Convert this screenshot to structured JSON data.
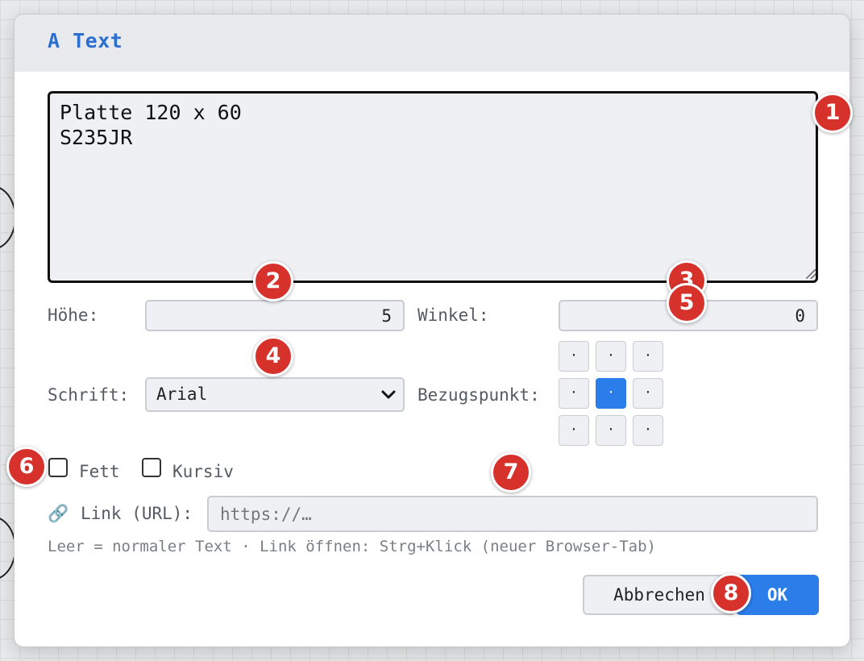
{
  "dialog": {
    "title": "A Text",
    "text_content": "Platte 120 x 60\nS235JR",
    "height": {
      "label": "Höhe:",
      "value": "5"
    },
    "angle": {
      "label": "Winkel:",
      "value": "0"
    },
    "font": {
      "label": "Schrift:",
      "selected": "Arial"
    },
    "reference": {
      "label": "Bezugspunkt:",
      "cells": [
        "·",
        "·",
        "·",
        "·",
        "·",
        "·",
        "·",
        "·",
        "·"
      ],
      "selected_index": 4
    },
    "bold": {
      "label": "Fett",
      "checked": false
    },
    "italic": {
      "label": "Kursiv",
      "checked": false
    },
    "link": {
      "icon": "🔗",
      "label": "Link (URL):",
      "placeholder": "https://…",
      "value": ""
    },
    "hint": "Leer = normaler Text · Link öffnen: Strg+Klick (neuer Browser-Tab)",
    "cancel_label": "Abbrechen",
    "ok_label": "OK"
  },
  "badges": [
    "1",
    "2",
    "3",
    "4",
    "5",
    "6",
    "7",
    "8"
  ],
  "colors": {
    "accent": "#2b7de9",
    "title": "#2b6fd1",
    "badge": "#d6312b"
  }
}
